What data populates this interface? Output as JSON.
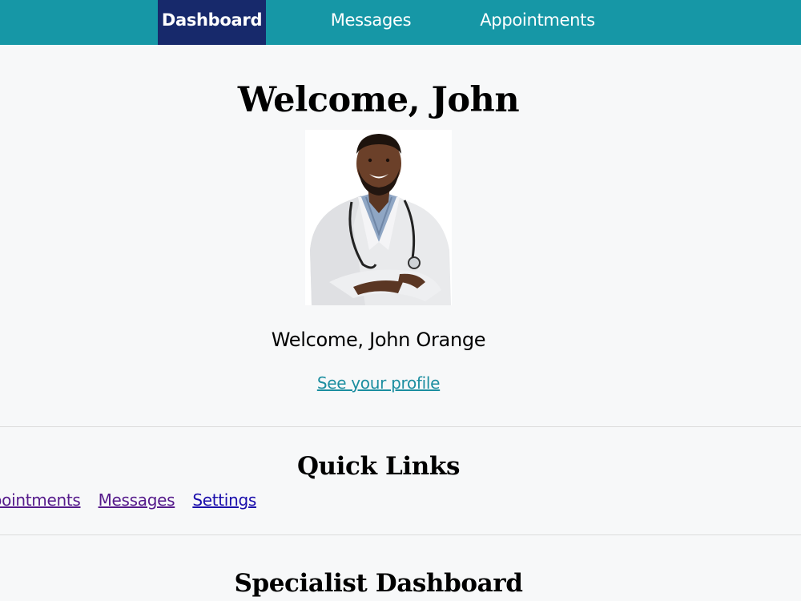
{
  "nav": {
    "tabs": [
      {
        "label": "Dashboard",
        "active": true
      },
      {
        "label": "Messages",
        "active": false
      },
      {
        "label": "Appointments",
        "active": false
      }
    ]
  },
  "hero": {
    "title": "Welcome, John",
    "subtitle": "Welcome, John Orange",
    "profile_link": "See your profile",
    "avatar_description": "doctor-portrait"
  },
  "quick_links": {
    "title": "Quick Links",
    "links": [
      {
        "label": "Appointments",
        "visited": true
      },
      {
        "label": "Messages",
        "visited": true
      },
      {
        "label": "Settings",
        "visited": false
      }
    ]
  },
  "specialist": {
    "title": "Specialist Dashboard"
  },
  "colors": {
    "nav_bg": "#1697a6",
    "nav_active_bg": "#17296b",
    "link": "#1b8ea0",
    "visited_link": "#551a8b",
    "unvisited_link": "#1a0dab",
    "page_bg": "#f7f8f9"
  }
}
